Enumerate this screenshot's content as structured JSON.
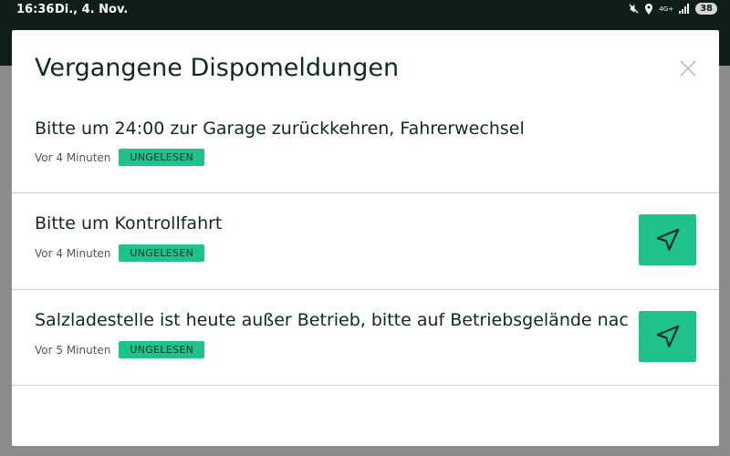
{
  "status_bar": {
    "time": "16:36",
    "date": "Di., 4. Nov.",
    "battery": "38",
    "network": "4G+"
  },
  "modal": {
    "title": "Vergangene Dispomeldungen"
  },
  "messages": [
    {
      "text": "Bitte um 24:00 zur Garage zurückkehren, Fahrerwechsel",
      "time": "Vor 4 Minuten",
      "badge": "UNGELESEN",
      "has_navigation": false
    },
    {
      "text": "Bitte um Kontrollfahrt",
      "time": "Vor 4 Minuten",
      "badge": "UNGELESEN",
      "has_navigation": true
    },
    {
      "text": "Salzladestelle ist heute außer Betrieb, bitte auf Betriebsgelände nachla...",
      "time": "Vor 5 Minuten",
      "badge": "UNGELESEN",
      "has_navigation": true
    }
  ],
  "colors": {
    "accent": "#1fc28a",
    "title": "#0f2a1d",
    "statusbar": "#0d1f17"
  }
}
